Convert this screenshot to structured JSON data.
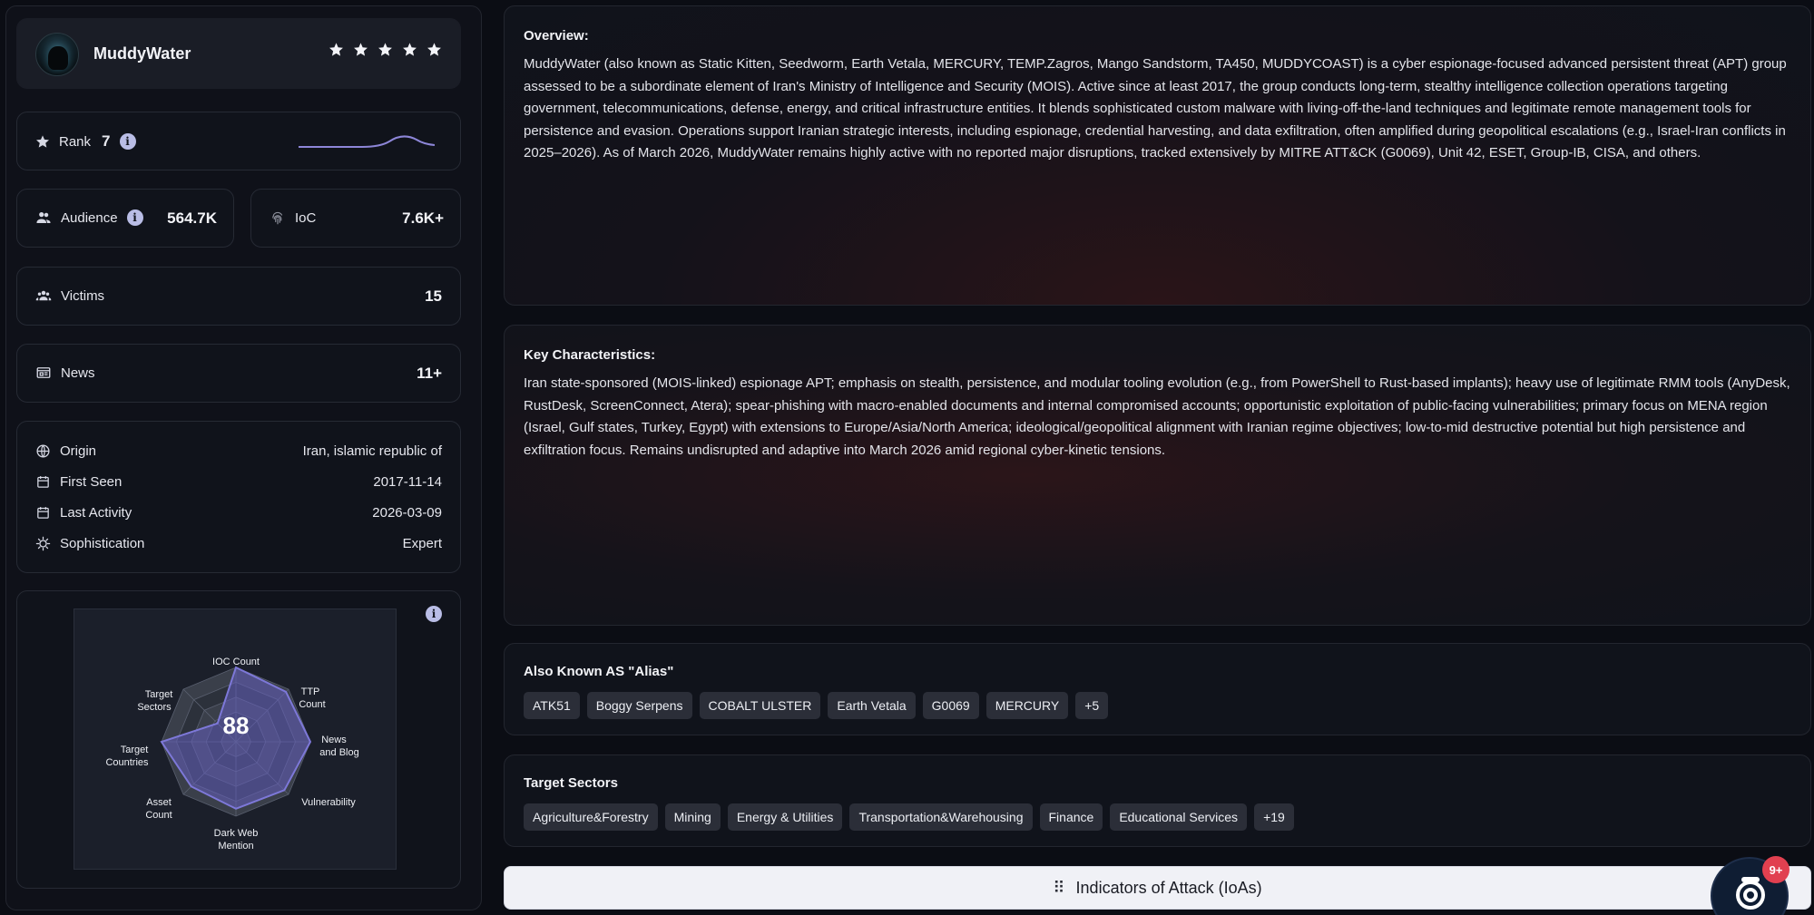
{
  "profile": {
    "name": "MuddyWater",
    "stars": 5
  },
  "rank": {
    "label": "Rank",
    "value": "7"
  },
  "audience": {
    "label": "Audience",
    "value": "564.7K"
  },
  "ioc": {
    "label": "IoC",
    "value": "7.6K+"
  },
  "victims": {
    "label": "Victims",
    "value": "15"
  },
  "news": {
    "label": "News",
    "value": "11+"
  },
  "meta": {
    "origin_label": "Origin",
    "origin_value": "Iran, islamic republic of",
    "first_seen_label": "First Seen",
    "first_seen_value": "2017-11-14",
    "last_activity_label": "Last Activity",
    "last_activity_value": "2026-03-09",
    "sophistication_label": "Sophistication",
    "sophistication_value": "Expert"
  },
  "radar": {
    "score": "88",
    "axes": [
      "IOC Count",
      "TTP Count",
      "News and Blog",
      "Vulnerability",
      "Dark Web Mention",
      "Asset Count",
      "Target Countries",
      "Target Sectors"
    ],
    "labels": {
      "ioc_count": "IOC Count",
      "ttp_1": "TTP",
      "ttp_2": "Count",
      "news_1": "News",
      "news_2": "and Blog",
      "vulnerability": "Vulnerability",
      "dark_1": "Dark Web",
      "dark_2": "Mention",
      "asset_1": "Asset",
      "asset_2": "Count",
      "countries_1": "Target",
      "countries_2": "Countries",
      "sectors_1": "Target",
      "sectors_2": "Sectors"
    },
    "values": [
      1.0,
      0.95,
      1.0,
      0.92,
      0.9,
      0.85,
      1.0,
      0.35
    ]
  },
  "overview": {
    "title": "Overview:",
    "text": "MuddyWater (also known as Static Kitten, Seedworm, Earth Vetala, MERCURY, TEMP.Zagros, Mango Sandstorm, TA450, MUDDYCOAST) is a cyber espionage-focused advanced persistent threat (APT) group assessed to be a subordinate element of Iran's Ministry of Intelligence and Security (MOIS). Active since at least 2017, the group conducts long-term, stealthy intelligence collection operations targeting government, telecommunications, defense, energy, and critical infrastructure entities. It blends sophisticated custom malware with living-off-the-land techniques and legitimate remote management tools for persistence and evasion. Operations support Iranian strategic interests, including espionage, credential harvesting, and data exfiltration, often amplified during geopolitical escalations (e.g., Israel-Iran conflicts in 2025–2026). As of March 2026, MuddyWater remains highly active with no reported major disruptions, tracked extensively by MITRE ATT&CK (G0069), Unit 42, ESET, Group-IB, CISA, and others."
  },
  "key_characteristics": {
    "title": "Key Characteristics:",
    "text": "Iran state-sponsored (MOIS-linked) espionage APT; emphasis on stealth, persistence, and modular tooling evolution (e.g., from PowerShell to Rust-based implants); heavy use of legitimate RMM tools (AnyDesk, RustDesk, ScreenConnect, Atera); spear-phishing with macro-enabled documents and internal compromised accounts; opportunistic exploitation of public-facing vulnerabilities; primary focus on MENA region (Israel, Gulf states, Turkey, Egypt) with extensions to Europe/Asia/North America; ideological/geopolitical alignment with Iranian regime objectives; low-to-mid destructive potential but high persistence and exfiltration focus. Remains undisrupted and adaptive into March 2026 amid regional cyber-kinetic tensions."
  },
  "alias": {
    "title": "Also Known AS \"Alias\"",
    "tags": [
      "ATK51",
      "Boggy Serpens",
      "COBALT ULSTER",
      "Earth Vetala",
      "G0069",
      "MERCURY",
      "+5"
    ]
  },
  "sectors": {
    "title": "Target Sectors",
    "tags": [
      "Agriculture&Forestry",
      "Mining",
      "Energy & Utilities",
      "Transportation&Warehousing",
      "Finance",
      "Educational Services",
      "+19"
    ]
  },
  "ioa": {
    "label": "Indicators of Attack (IoAs)"
  },
  "fab": {
    "badge": "9+"
  }
}
